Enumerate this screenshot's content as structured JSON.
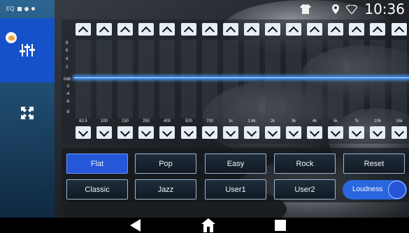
{
  "statusbar": {
    "app_tag": "EQ",
    "time": "10:36",
    "icons": [
      "image-icon",
      "settings-icon",
      "dot-icon",
      "shirt-icon",
      "location-icon",
      "wifi-icon"
    ]
  },
  "sidebar": {
    "items": [
      {
        "name": "equalizer",
        "icon": "equalizer-sliders-icon",
        "active": true
      },
      {
        "name": "balance",
        "icon": "expand-corners-icon",
        "active": false
      }
    ]
  },
  "eq": {
    "db_labels": [
      "8",
      "6",
      "4",
      "2",
      "0db",
      "-2",
      "-4",
      "-6",
      "-8"
    ],
    "bands": [
      {
        "freq": "62.5",
        "gain": 0
      },
      {
        "freq": "100",
        "gain": 0
      },
      {
        "freq": "150",
        "gain": 0
      },
      {
        "freq": "250",
        "gain": 0
      },
      {
        "freq": "400",
        "gain": 0
      },
      {
        "freq": "500",
        "gain": 0
      },
      {
        "freq": "700",
        "gain": 0
      },
      {
        "freq": "1k",
        "gain": 0
      },
      {
        "freq": "1.6k",
        "gain": 0
      },
      {
        "freq": "2k",
        "gain": 0
      },
      {
        "freq": "3k",
        "gain": 0
      },
      {
        "freq": "4k",
        "gain": 0
      },
      {
        "freq": "5k",
        "gain": 0
      },
      {
        "freq": "7k",
        "gain": 0
      },
      {
        "freq": "10k",
        "gain": 0
      },
      {
        "freq": "16k",
        "gain": 0
      }
    ]
  },
  "presets": {
    "row1": [
      "Flat",
      "Pop",
      "Easy",
      "Rock",
      "Reset"
    ],
    "row2": [
      "Classic",
      "Jazz",
      "User1",
      "User2"
    ],
    "selected": "Flat",
    "loudness_label": "Loudness",
    "loudness_on": true
  },
  "colors": {
    "accent": "#1551c9",
    "eq_line": "#2c7ef0",
    "button_border": "#9fb6d0"
  },
  "navbar": {
    "icons": [
      "back-icon",
      "home-icon",
      "recents-icon"
    ]
  }
}
